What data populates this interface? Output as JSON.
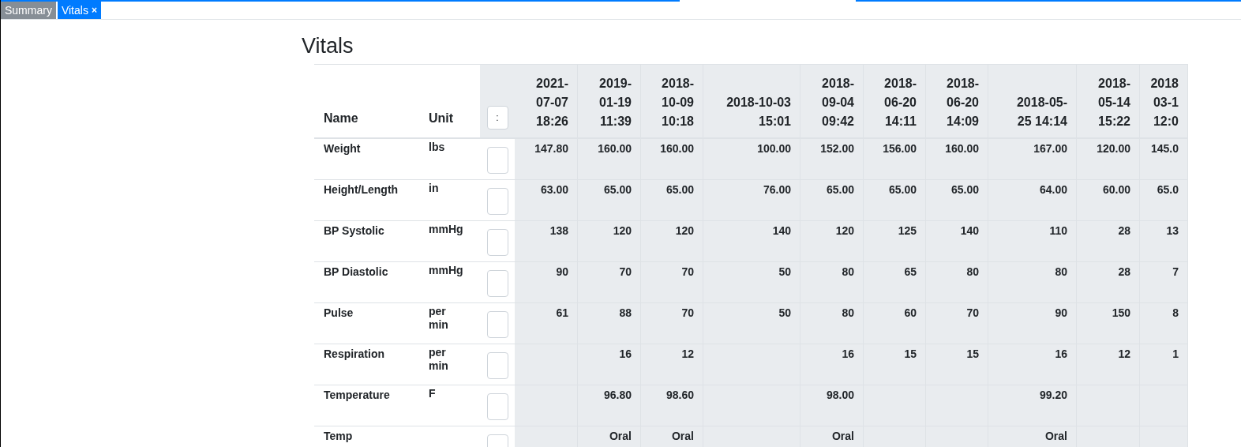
{
  "tabs": [
    {
      "label": "Summary",
      "selected": false
    },
    {
      "label": "Vitals",
      "selected": true,
      "close": "×"
    }
  ],
  "page": {
    "title": "Vitals"
  },
  "table": {
    "columns": {
      "name": "Name",
      "unit": "Unit",
      "menu": ":"
    },
    "dates": [
      [
        "2021-",
        "07-07",
        "18:26"
      ],
      [
        "2019-",
        "01-19",
        "11:39"
      ],
      [
        "2018-",
        "10-09",
        "10:18"
      ],
      [
        "2018-10-03",
        "15:01"
      ],
      [
        "2018-",
        "09-04",
        "09:42"
      ],
      [
        "2018-",
        "06-20",
        "14:11"
      ],
      [
        "2018-",
        "06-20",
        "14:09"
      ],
      [
        "2018-05-",
        "25 14:14"
      ],
      [
        "2018-",
        "05-14",
        "15:22"
      ],
      [
        "2018",
        "03-1",
        "12:0"
      ]
    ],
    "rows": [
      {
        "name": "Weight",
        "unit": "lbs",
        "checked": false,
        "values": {
          "col_1": "147.80",
          "col_2": "160.00",
          "col_3": "160.00",
          "col_4": "100.00",
          "col_5": "152.00",
          "col_6": "156.00",
          "col_7": "160.00",
          "col_8": "167.00",
          "col_9": "120.00",
          "col_10": "145.0"
        }
      },
      {
        "name": "Height/Length",
        "unit": "in",
        "checked": false,
        "values": {
          "col_1": "63.00",
          "col_2": "65.00",
          "col_3": "65.00",
          "col_4": "76.00",
          "col_5": "65.00",
          "col_6": "65.00",
          "col_7": "65.00",
          "col_8": "64.00",
          "col_9": "60.00",
          "col_10": "65.0"
        }
      },
      {
        "name": "BP Systolic",
        "unit": "mmHg",
        "checked": false,
        "values": {
          "col_1": "138",
          "col_2": "120",
          "col_3": "120",
          "col_4": "140",
          "col_5": "120",
          "col_6": "125",
          "col_7": "140",
          "col_8": "110",
          "col_9": "28",
          "col_10": "13"
        }
      },
      {
        "name": "BP Diastolic",
        "unit": "mmHg",
        "checked": false,
        "values": {
          "col_1": "90",
          "col_2": "70",
          "col_3": "70",
          "col_4": "50",
          "col_5": "80",
          "col_6": "65",
          "col_7": "80",
          "col_8": "80",
          "col_9": "28",
          "col_10": "7"
        }
      },
      {
        "name": "Pulse",
        "unit": "per min",
        "checked": false,
        "values": {
          "col_1": "61",
          "col_2": "88",
          "col_3": "70",
          "col_4": "50",
          "col_5": "80",
          "col_6": "60",
          "col_7": "70",
          "col_8": "90",
          "col_9": "150",
          "col_10": "8"
        }
      },
      {
        "name": "Respiration",
        "unit": "per min",
        "checked": false,
        "values": {
          "col_2": "16",
          "col_3": "12",
          "col_5": "16",
          "col_6": "15",
          "col_7": "15",
          "col_8": "16",
          "col_9": "12",
          "col_10": "1"
        }
      },
      {
        "name": "Temperature",
        "unit": "F",
        "checked": false,
        "values": {
          "col_2": "96.80",
          "col_3": "98.60",
          "col_5": "98.00",
          "col_8": "99.20"
        }
      },
      {
        "name": "Temp",
        "checked": false,
        "values": {
          "col_2": "Oral",
          "col_3": "Oral",
          "col_5": "Oral",
          "col_8": "Oral"
        }
      }
    ]
  }
}
